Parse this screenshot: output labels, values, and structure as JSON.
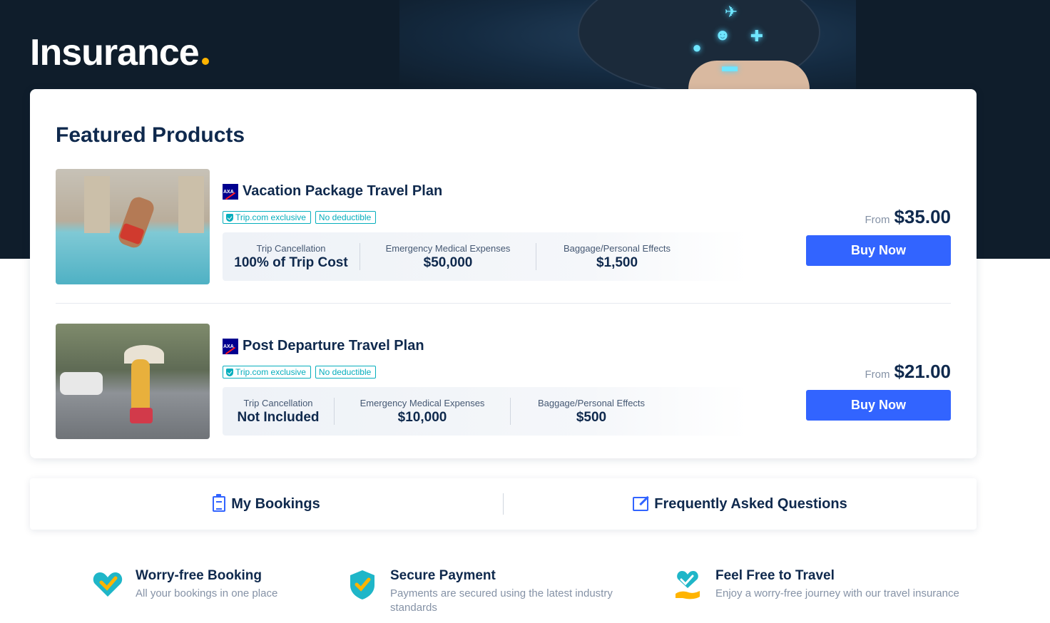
{
  "header": {
    "title": "Insurance"
  },
  "featured": {
    "title": "Featured Products",
    "products": [
      {
        "name": "Vacation Package Travel Plan",
        "tags": [
          "Trip.com exclusive",
          "No deductible"
        ],
        "benefits": [
          {
            "label": "Trip Cancellation",
            "value": "100% of Trip Cost"
          },
          {
            "label": "Emergency Medical Expenses",
            "value": "$50,000"
          },
          {
            "label": "Baggage/Personal Effects",
            "value": "$1,500"
          }
        ],
        "from_label": "From",
        "price": "$35.00",
        "button": "Buy Now"
      },
      {
        "name": "Post Departure Travel Plan",
        "tags": [
          "Trip.com exclusive",
          "No deductible"
        ],
        "benefits": [
          {
            "label": "Trip Cancellation",
            "value": "Not Included"
          },
          {
            "label": "Emergency Medical Expenses",
            "value": "$10,000"
          },
          {
            "label": "Baggage/Personal Effects",
            "value": "$500"
          }
        ],
        "from_label": "From",
        "price": "$21.00",
        "button": "Buy Now"
      }
    ]
  },
  "quick_links": {
    "bookings": "My Bookings",
    "faq": "Frequently Asked Questions"
  },
  "features": [
    {
      "title": "Worry-free Booking",
      "desc": "All your bookings in one place",
      "icon": "heart-check-icon"
    },
    {
      "title": "Secure Payment",
      "desc": "Payments are secured using the latest industry standards",
      "icon": "shield-check-icon"
    },
    {
      "title": "Feel Free to Travel",
      "desc": "Enjoy a worry-free journey with our travel insurance",
      "icon": "heart-hand-icon"
    }
  ],
  "colors": {
    "hero_bg": "#0f1d2b",
    "primary": "#3264ff",
    "accent_dot": "#ffb400",
    "tag": "#06aebd",
    "text": "#0f294d"
  }
}
